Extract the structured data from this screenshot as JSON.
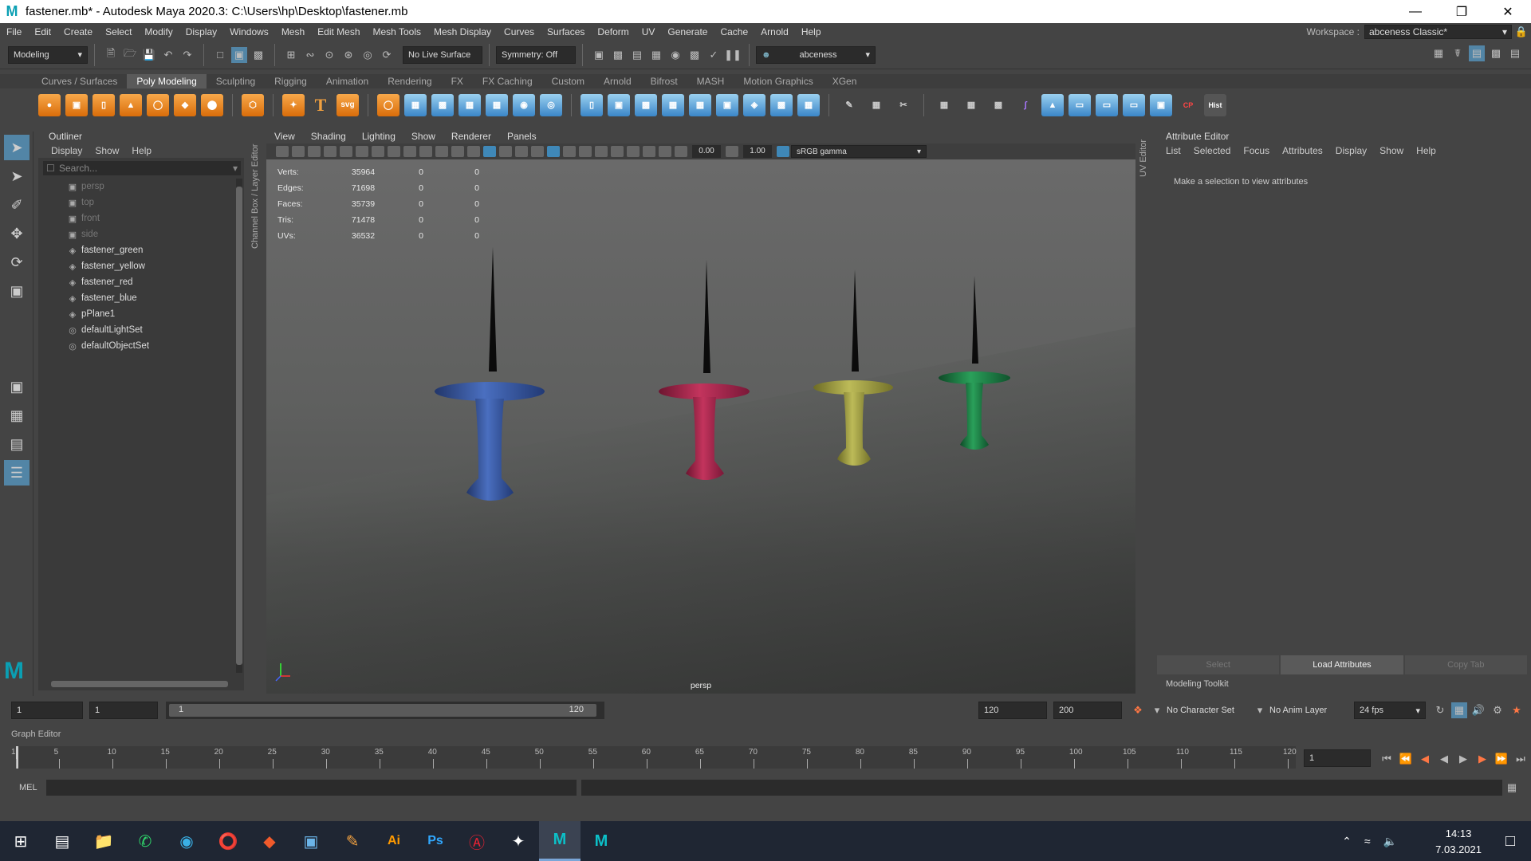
{
  "window": {
    "title": "fastener.mb* - Autodesk Maya 2020.3: C:\\Users\\hp\\Desktop\\fastener.mb",
    "logo": "M"
  },
  "menubar": {
    "items": [
      "File",
      "Edit",
      "Create",
      "Select",
      "Modify",
      "Display",
      "Windows",
      "Mesh",
      "Edit Mesh",
      "Mesh Tools",
      "Mesh Display",
      "Curves",
      "Surfaces",
      "Deform",
      "UV",
      "Generate",
      "Cache",
      "Arnold",
      "Help"
    ],
    "workspace_label": "Workspace :",
    "workspace_value": "abceness Classic*"
  },
  "statusline": {
    "mode": "Modeling",
    "live_surface": "No Live Surface",
    "symmetry": "Symmetry: Off",
    "user": "abceness"
  },
  "shelf_tabs": {
    "items": [
      "Curves / Surfaces",
      "Poly Modeling",
      "Sculpting",
      "Rigging",
      "Animation",
      "Rendering",
      "FX",
      "FX Caching",
      "Custom",
      "Arnold",
      "Bifrost",
      "MASH",
      "Motion Graphics",
      "XGen"
    ],
    "active": "Poly Modeling"
  },
  "shelf_labels": {
    "text": "T",
    "svg": "svg",
    "cp": "CP",
    "hist": "Hist"
  },
  "outliner": {
    "title": "Outliner",
    "menu": [
      "Display",
      "Show",
      "Help"
    ],
    "search_placeholder": "Search...",
    "items": [
      {
        "label": "persp",
        "type": "camera",
        "dim": true
      },
      {
        "label": "top",
        "type": "camera",
        "dim": true
      },
      {
        "label": "front",
        "type": "camera",
        "dim": true
      },
      {
        "label": "side",
        "type": "camera",
        "dim": true
      },
      {
        "label": "fastener_green",
        "type": "mesh",
        "dim": false
      },
      {
        "label": "fastener_yellow",
        "type": "mesh",
        "dim": false
      },
      {
        "label": "fastener_red",
        "type": "mesh",
        "dim": false
      },
      {
        "label": "fastener_blue",
        "type": "mesh",
        "dim": false
      },
      {
        "label": "pPlane1",
        "type": "mesh",
        "dim": false
      },
      {
        "label": "defaultLightSet",
        "type": "set",
        "dim": false
      },
      {
        "label": "defaultObjectSet",
        "type": "set",
        "dim": false
      }
    ]
  },
  "channel_box_label": "Channel Box / Layer Editor",
  "uv_editor_label": "UV Editor",
  "viewport": {
    "menu": [
      "View",
      "Shading",
      "Lighting",
      "Show",
      "Renderer",
      "Panels"
    ],
    "exposure": "0.00",
    "gamma": "1.00",
    "color_space": "sRGB gamma",
    "camera": "persp",
    "hud": [
      {
        "label": "Verts:",
        "value": "35964",
        "sel": "0",
        "comp": "0"
      },
      {
        "label": "Edges:",
        "value": "71698",
        "sel": "0",
        "comp": "0"
      },
      {
        "label": "Faces:",
        "value": "35739",
        "sel": "0",
        "comp": "0"
      },
      {
        "label": "Tris:",
        "value": "71478",
        "sel": "0",
        "comp": "0"
      },
      {
        "label": "UVs:",
        "value": "36532",
        "sel": "0",
        "comp": "0"
      }
    ],
    "fasteners": [
      {
        "name": "fastener_blue",
        "color": "#3a5ba6"
      },
      {
        "name": "fastener_red",
        "color": "#b8254f"
      },
      {
        "name": "fastener_yellow",
        "color": "#a8a547"
      },
      {
        "name": "fastener_green",
        "color": "#1f8a4b"
      }
    ]
  },
  "attribute_editor": {
    "title": "Attribute Editor",
    "menu": [
      "List",
      "Selected",
      "Focus",
      "Attributes",
      "Display",
      "Show",
      "Help"
    ],
    "message": "Make a selection to view attributes",
    "buttons": [
      "Select",
      "Load Attributes",
      "Copy Tab"
    ],
    "toolkit": "Modeling Toolkit"
  },
  "range": {
    "start": "1",
    "current_start": "1",
    "slider_start": "1",
    "slider_end": "120",
    "end": "120",
    "anim_end": "200",
    "character_set": "No Character Set",
    "anim_layer": "No Anim Layer",
    "fps": "24 fps"
  },
  "graph_editor_label": "Graph Editor",
  "timeline": {
    "ticks": [
      "1",
      "5",
      "10",
      "15",
      "20",
      "25",
      "30",
      "35",
      "40",
      "45",
      "50",
      "55",
      "60",
      "65",
      "70",
      "75",
      "80",
      "85",
      "90",
      "95",
      "100",
      "105",
      "110",
      "115",
      "120"
    ],
    "current_frame": "1"
  },
  "mel": {
    "label": "MEL"
  },
  "taskbar": {
    "time": "14:13",
    "date": "7.03.2021",
    "apps": [
      "windows-start",
      "task-view",
      "file-explorer",
      "whatsapp",
      "edge",
      "opera",
      "app-red",
      "app-blue",
      "pen",
      "illustrator",
      "photoshop",
      "app-s",
      "zbrush",
      "maya",
      "maya"
    ]
  }
}
